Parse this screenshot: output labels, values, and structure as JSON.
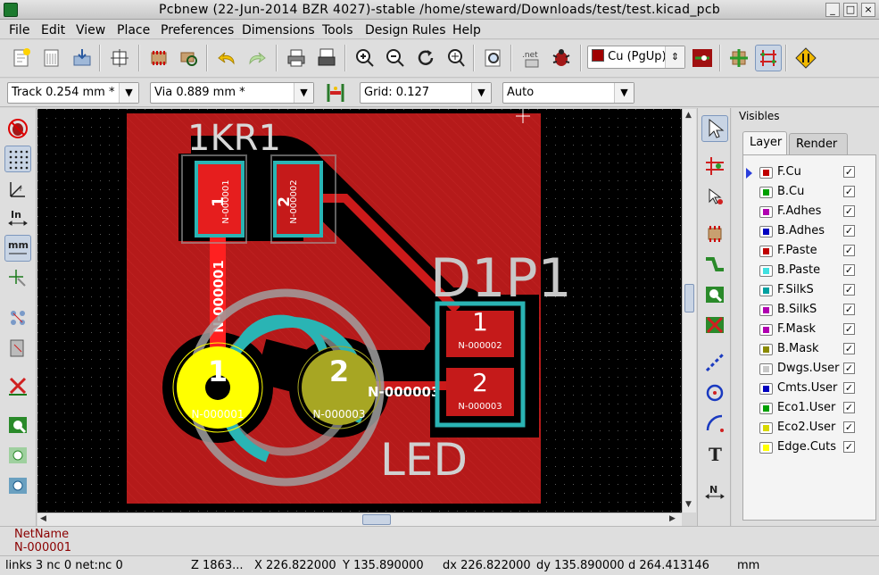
{
  "window": {
    "title": "Pcbnew (22-Jun-2014 BZR 4027)-stable /home/steward/Downloads/test/test.kicad_pcb"
  },
  "menu": [
    {
      "label": "File"
    },
    {
      "label": "Edit"
    },
    {
      "label": "View"
    },
    {
      "label": "Place"
    },
    {
      "label": "Preferences"
    },
    {
      "label": "Dimensions"
    },
    {
      "label": "Tools"
    },
    {
      "label": "Design Rules"
    },
    {
      "label": "Help"
    }
  ],
  "toolbar": {
    "layer_select": "Cu (PgUp)",
    "track_width": "Track 0.254 mm *",
    "via_size": "Via 0.889 mm *",
    "grid": "Grid: 0.127",
    "zoom": "Auto"
  },
  "canvas": {
    "ref_r1": "1KR1",
    "ref_d1p1": "D1P1",
    "value_led": "LED",
    "r1_pad1": "1",
    "r1_pad1_net": "N-000001",
    "r1_pad2": "2",
    "r1_pad2_net": "N-000002",
    "track_label_left": "N-000001",
    "d1_pad1": "1",
    "d1_pad1_net": "N-000001",
    "d1_pad2": "2",
    "d1_pad2_net": "N-000003",
    "p1_pad1": "1",
    "p1_pad1_net": "N-000002",
    "p1_pad2": "2",
    "p1_pad2_net": "N-000003",
    "track_label_right": "N-000003",
    "colors": {
      "board": "#b51a1a",
      "copper_pad": "#e61e1e",
      "silk": "#2ab4b4",
      "via_yellow": "#ffff00",
      "via_olive": "#a7a623",
      "fab_gray": "#a0a0a0"
    }
  },
  "visibles": {
    "title": "Visibles",
    "tabs": [
      {
        "label": "Layer"
      },
      {
        "label": "Render"
      }
    ],
    "layers": [
      {
        "name": "F.Cu",
        "color": "#c00000",
        "selected": true
      },
      {
        "name": "B.Cu",
        "color": "#00a000",
        "selected": false
      },
      {
        "name": "F.Adhes",
        "color": "#b000b0",
        "selected": false
      },
      {
        "name": "B.Adhes",
        "color": "#0000c0",
        "selected": false
      },
      {
        "name": "F.Paste",
        "color": "#c00000",
        "selected": false
      },
      {
        "name": "B.Paste",
        "color": "#40e0e0",
        "selected": false
      },
      {
        "name": "F.SilkS",
        "color": "#00a0a0",
        "selected": false
      },
      {
        "name": "B.SilkS",
        "color": "#b000b0",
        "selected": false
      },
      {
        "name": "F.Mask",
        "color": "#b000b0",
        "selected": false
      },
      {
        "name": "B.Mask",
        "color": "#8a8a00",
        "selected": false
      },
      {
        "name": "Dwgs.User",
        "color": "#c8c8c8",
        "selected": false
      },
      {
        "name": "Cmts.User",
        "color": "#0000c0",
        "selected": false
      },
      {
        "name": "Eco1.User",
        "color": "#00a000",
        "selected": false
      },
      {
        "name": "Eco2.User",
        "color": "#d8d800",
        "selected": false
      },
      {
        "name": "Edge.Cuts",
        "color": "#ffff00",
        "selected": false
      }
    ]
  },
  "message": {
    "line1": "NetName",
    "line2": "N-000001"
  },
  "status": {
    "links": "links 3 nc 0  net:nc 0",
    "zoom": "Z 1863...",
    "x": "X 226.822000",
    "y": "Y 135.890000",
    "dx": "dx 226.822000",
    "dy": "dy 135.890000",
    "d": "d 264.413146",
    "unit": "mm"
  }
}
